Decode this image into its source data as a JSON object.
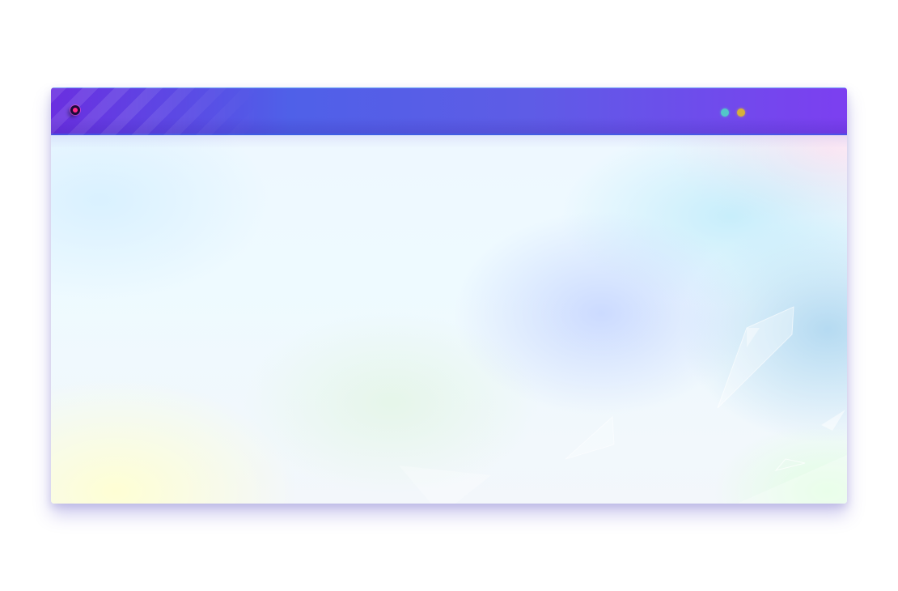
{
  "window": {
    "titlebar": {
      "record_icon": "record-icon",
      "indicators": [
        {
          "name": "status-dot-teal",
          "color": "#53c6c9"
        },
        {
          "name": "status-dot-amber",
          "color": "#d6b03a"
        }
      ]
    },
    "colors": {
      "titlebar_start": "#6a2fe0",
      "titlebar_mid": "#4f60e8",
      "titlebar_end": "#7c3ff0",
      "record_dot": "#ff2a8a"
    }
  }
}
